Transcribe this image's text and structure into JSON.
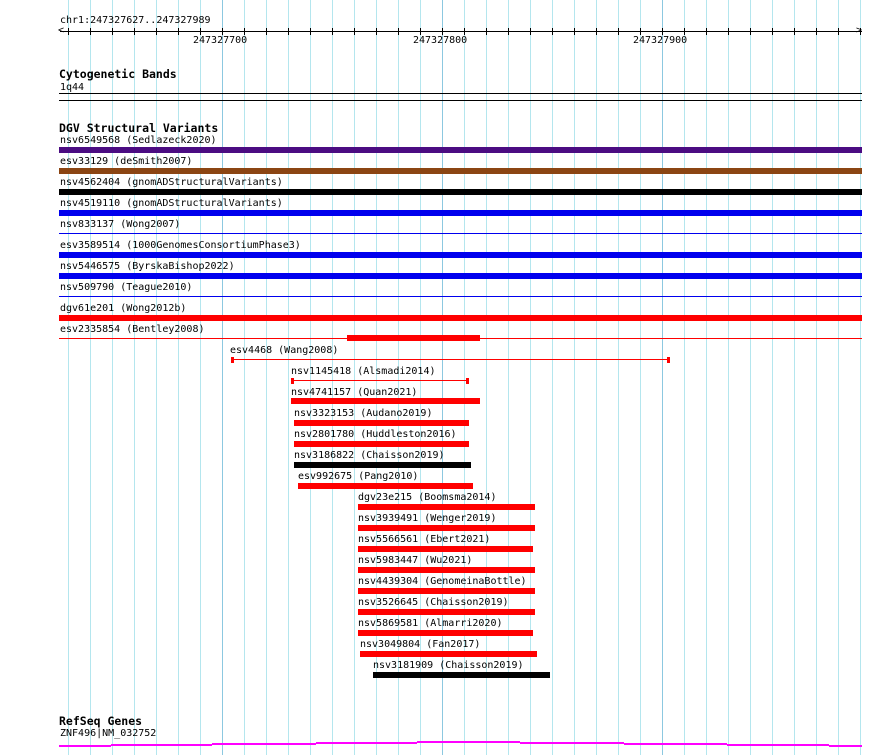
{
  "ruler": {
    "location": "chr1:247327627..247327989",
    "major_labels": [
      "247327700",
      "247327800",
      "247327900"
    ]
  },
  "tracks": {
    "cytoband": {
      "title": "Cytogenetic Bands",
      "band": "1q44"
    },
    "dgv": {
      "title": "DGV Structural Variants",
      "features": [
        {
          "label": "nsv6549568 (Sedlazeck2020)",
          "color": "#4b0c82"
        },
        {
          "label": "esv33129 (deSmith2007)",
          "color": "#8b4513"
        },
        {
          "label": "nsv4562404 (gnomADStructuralVariants)",
          "color": "#000000"
        },
        {
          "label": "nsv4519110 (gnomADStructuralVariants)",
          "color": "#0000ee"
        },
        {
          "label": "nsv833137 (Wong2007)",
          "color": "#0000ee"
        },
        {
          "label": "esv3589514 (1000GenomesConsortiumPhase3)",
          "color": "#0000ee"
        },
        {
          "label": "nsv5446575 (ByrskaBishop2022)",
          "color": "#0000ee"
        },
        {
          "label": "nsv509790 (Teague2010)",
          "color": "#0000ee"
        },
        {
          "label": "dgv61e201 (Wong2012b)",
          "color": "#ff0000"
        },
        {
          "label": "esv2335854 (Bentley2008)",
          "color": "#ff0000"
        },
        {
          "label": "esv4468 (Wang2008)",
          "color": "#ff0000"
        },
        {
          "label": "nsv1145418 (Alsmadi2014)",
          "color": "#ff0000"
        },
        {
          "label": "nsv4741157 (Quan2021)",
          "color": "#ff0000"
        },
        {
          "label": "nsv3323153 (Audano2019)",
          "color": "#ff0000"
        },
        {
          "label": "nsv2801780 (Huddleston2016)",
          "color": "#ff0000"
        },
        {
          "label": "nsv3186822 (Chaisson2019)",
          "color": "#000000"
        },
        {
          "label": "esv992675 (Pang2010)",
          "color": "#ff0000"
        },
        {
          "label": "dgv23e215 (Boomsma2014)",
          "color": "#ff0000"
        },
        {
          "label": "nsv3939491 (Wenger2019)",
          "color": "#ff0000"
        },
        {
          "label": "nsv5566561 (Ebert2021)",
          "color": "#ff0000"
        },
        {
          "label": "nsv5983447 (Wu2021)",
          "color": "#ff0000"
        },
        {
          "label": "nsv4439304 (GenomeinaBottle)",
          "color": "#ff0000"
        },
        {
          "label": "nsv3526645 (Chaisson2019)",
          "color": "#ff0000"
        },
        {
          "label": "nsv5869581 (Almarri2020)",
          "color": "#ff0000"
        },
        {
          "label": "nsv3049804 (Fan2017)",
          "color": "#ff0000"
        },
        {
          "label": "nsv3181909 (Chaisson2019)",
          "color": "#000000"
        }
      ]
    },
    "refseq": {
      "title": "RefSeq Genes",
      "gene": "ZNF496|NM_032752",
      "color": "#ff00ff"
    }
  }
}
